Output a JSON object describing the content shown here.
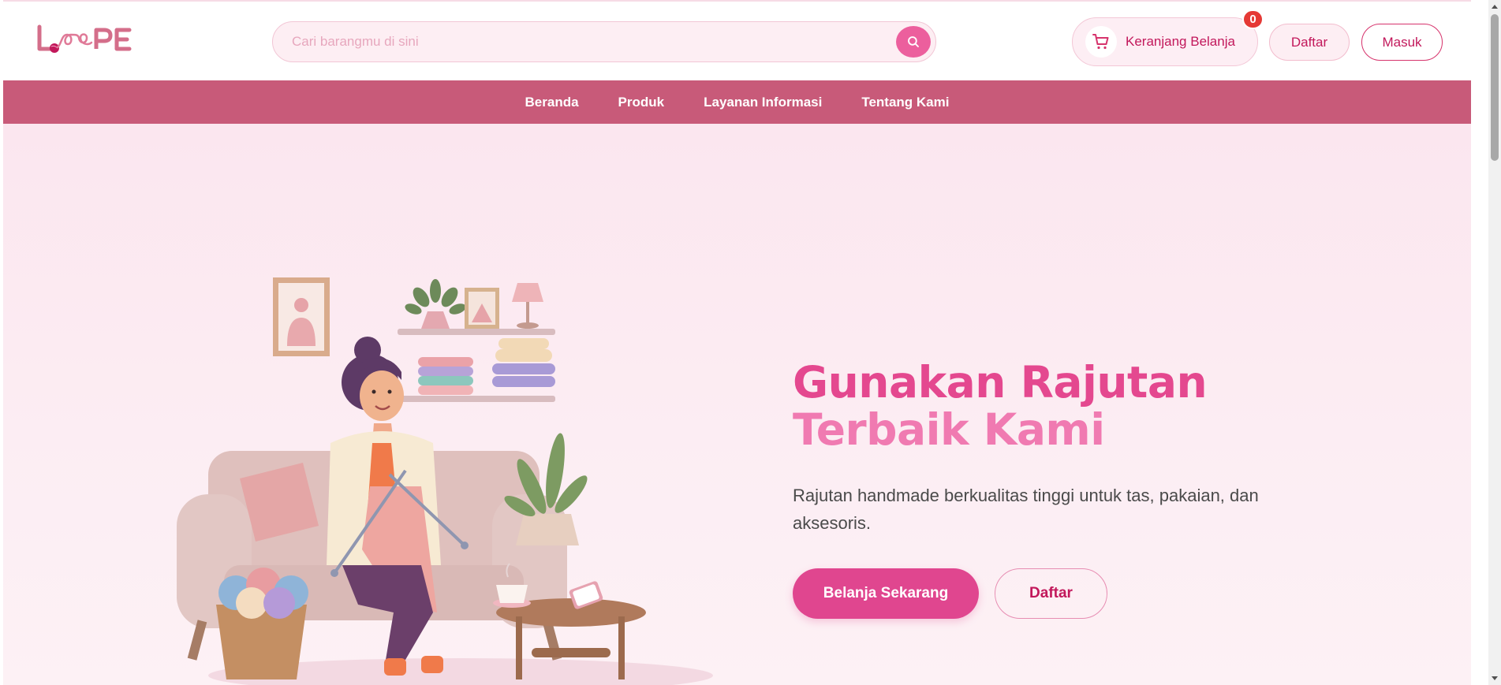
{
  "brand": {
    "logo_text": "LOOPE"
  },
  "search": {
    "placeholder": "Cari barangmu di sini"
  },
  "header": {
    "cart_label": "Keranjang Belanja",
    "cart_count": "0",
    "register_label": "Daftar",
    "login_label": "Masuk"
  },
  "nav": {
    "items": [
      {
        "label": "Beranda"
      },
      {
        "label": "Produk"
      },
      {
        "label": "Layanan Informasi"
      },
      {
        "label": "Tentang Kami"
      }
    ]
  },
  "hero": {
    "title_line1": "Gunakan Rajutan",
    "title_line2": "Terbaik Kami",
    "subtitle": "Rajutan handmade berkualitas tinggi untuk tas, pakaian, dan aksesoris.",
    "primary_cta": "Belanja Sekarang",
    "secondary_cta": "Daftar"
  },
  "colors": {
    "brand_pink": "#e0468f",
    "nav_bg": "#c85a79",
    "badge_red": "#e53935",
    "hero_bg": "#fbe6ef"
  },
  "icons": {
    "search": "search-icon",
    "cart": "cart-icon"
  }
}
